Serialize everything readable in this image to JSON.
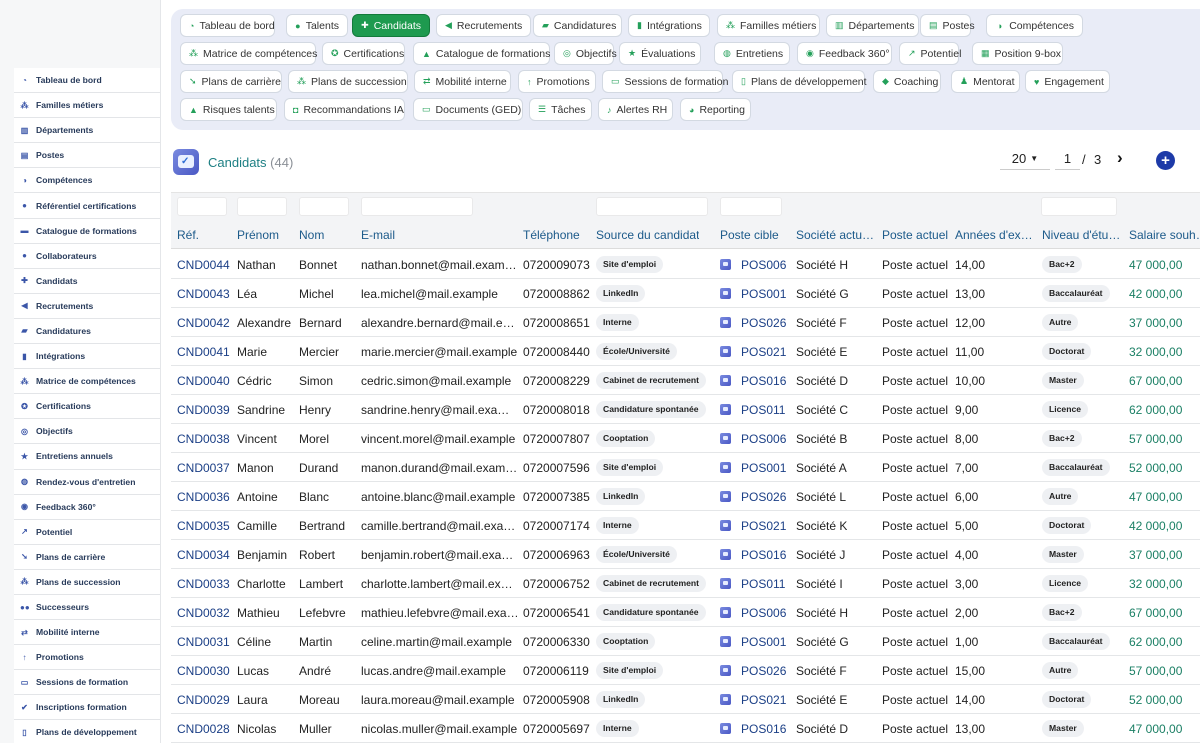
{
  "sidebar": {
    "items": [
      {
        "label": "Tableau de bord",
        "icon": "dashboard-icon"
      },
      {
        "label": "Familles métiers",
        "icon": "sitemap-icon"
      },
      {
        "label": "Départements",
        "icon": "building-icon"
      },
      {
        "label": "Postes",
        "icon": "id-card-icon"
      },
      {
        "label": "Compétences",
        "icon": "brain-icon"
      },
      {
        "label": "Référentiel certifications",
        "icon": "certificate-icon"
      },
      {
        "label": "Catalogue de formations",
        "icon": "book-icon"
      },
      {
        "label": "Collaborateurs",
        "icon": "user-icon"
      },
      {
        "label": "Candidats",
        "icon": "user-plus-icon"
      },
      {
        "label": "Recrutements",
        "icon": "megaphone-icon"
      },
      {
        "label": "Candidatures",
        "icon": "file-icon"
      },
      {
        "label": "Intégrations",
        "icon": "door-icon"
      },
      {
        "label": "Matrice de compétences",
        "icon": "sitemap-icon"
      },
      {
        "label": "Certifications",
        "icon": "award-icon"
      },
      {
        "label": "Objectifs",
        "icon": "target-icon"
      },
      {
        "label": "Entretiens annuels",
        "icon": "star-icon"
      },
      {
        "label": "Rendez-vous d'entretien",
        "icon": "chat-icon"
      },
      {
        "label": "Feedback 360°",
        "icon": "comment-icon"
      },
      {
        "label": "Potentiel",
        "icon": "chart-icon"
      },
      {
        "label": "Plans de carrière",
        "icon": "route-icon"
      },
      {
        "label": "Plans de succession",
        "icon": "sitemap-icon"
      },
      {
        "label": "Successeurs",
        "icon": "users-icon"
      },
      {
        "label": "Mobilité interne",
        "icon": "exchange-icon"
      },
      {
        "label": "Promotions",
        "icon": "arrow-up-icon"
      },
      {
        "label": "Sessions de formation",
        "icon": "presentation-icon"
      },
      {
        "label": "Inscriptions formation",
        "icon": "user-check-icon"
      },
      {
        "label": "Plans de développement",
        "icon": "clipboard-icon"
      }
    ]
  },
  "topnav": {
    "rows": [
      [
        {
          "label": "Tableau de bord",
          "icon": "dashboard-icon"
        },
        {
          "label": "Talents",
          "icon": "user-icon"
        },
        {
          "label": "Candidats",
          "icon": "user-plus-icon",
          "active": true
        },
        {
          "label": "Recrutements",
          "icon": "megaphone-icon"
        },
        {
          "label": "Candidatures",
          "icon": "file-icon"
        },
        {
          "label": "Intégrations",
          "icon": "door-icon"
        },
        {
          "label": "Familles métiers",
          "icon": "sitemap-icon"
        },
        {
          "label": "Départements",
          "icon": "building-icon"
        },
        {
          "label": "Postes",
          "icon": "id-card-icon"
        },
        {
          "label": "Compétences",
          "icon": "brain-icon"
        }
      ],
      [
        {
          "label": "Matrice de compétences",
          "icon": "sitemap-icon"
        },
        {
          "label": "Certifications",
          "icon": "award-icon"
        },
        {
          "label": "Catalogue de formations",
          "icon": "graduation-icon"
        },
        {
          "label": "Objectifs",
          "icon": "target-icon"
        },
        {
          "label": "Évaluations",
          "icon": "star-icon"
        },
        {
          "label": "Entretiens",
          "icon": "chat-icon"
        },
        {
          "label": "Feedback 360°",
          "icon": "comment-icon"
        },
        {
          "label": "Potentiel",
          "icon": "chart-icon"
        },
        {
          "label": "Position 9-box",
          "icon": "grid-icon"
        }
      ],
      [
        {
          "label": "Plans de carrière",
          "icon": "route-icon"
        },
        {
          "label": "Plans de succession",
          "icon": "sitemap-icon"
        },
        {
          "label": "Mobilité interne",
          "icon": "exchange-icon"
        },
        {
          "label": "Promotions",
          "icon": "arrow-up-icon"
        },
        {
          "label": "Sessions de formation",
          "icon": "presentation-icon"
        },
        {
          "label": "Plans de développement",
          "icon": "clipboard-icon"
        },
        {
          "label": "Coaching",
          "icon": "handshake-icon"
        },
        {
          "label": "Mentorat",
          "icon": "user-tie-icon"
        },
        {
          "label": "Engagement",
          "icon": "heart-icon"
        }
      ],
      [
        {
          "label": "Risques talents",
          "icon": "warning-icon"
        },
        {
          "label": "Recommandations IA",
          "icon": "robot-icon"
        },
        {
          "label": "Documents (GED)",
          "icon": "folder-icon"
        },
        {
          "label": "Tâches",
          "icon": "tasks-icon"
        },
        {
          "label": "Alertes RH",
          "icon": "bell-icon"
        },
        {
          "label": "Reporting",
          "icon": "pie-icon"
        }
      ]
    ]
  },
  "page": {
    "title": "Candidats",
    "count": "(44)",
    "page_size": "20",
    "current_page": "1",
    "separator": "/",
    "total_pages": "3",
    "next": "›",
    "add": "+"
  },
  "table": {
    "columns": [
      "Réf.",
      "Prénom",
      "Nom",
      "E-mail",
      "Téléphone",
      "Source du candidat",
      "Poste cible",
      "Société actuelle",
      "Poste actuel",
      "Années d'expérience",
      "Niveau d'études",
      "Salaire souhaité"
    ],
    "rows": [
      [
        "CND0044",
        "Nathan",
        "Bonnet",
        "nathan.bonnet@mail.example",
        "0720009073",
        "Site d'emploi",
        "POS006",
        "Société H",
        "Poste actuel",
        "14,00",
        "Bac+2",
        "47 000,00"
      ],
      [
        "CND0043",
        "Léa",
        "Michel",
        "lea.michel@mail.example",
        "0720008862",
        "LinkedIn",
        "POS001",
        "Société G",
        "Poste actuel",
        "13,00",
        "Baccalauréat",
        "42 000,00"
      ],
      [
        "CND0042",
        "Alexandre",
        "Bernard",
        "alexandre.bernard@mail.example",
        "0720008651",
        "Interne",
        "POS026",
        "Société F",
        "Poste actuel",
        "12,00",
        "Autre",
        "37 000,00"
      ],
      [
        "CND0041",
        "Marie",
        "Mercier",
        "marie.mercier@mail.example",
        "0720008440",
        "École/Université",
        "POS021",
        "Société E",
        "Poste actuel",
        "11,00",
        "Doctorat",
        "32 000,00"
      ],
      [
        "CND0040",
        "Cédric",
        "Simon",
        "cedric.simon@mail.example",
        "0720008229",
        "Cabinet de recrutement",
        "POS016",
        "Société D",
        "Poste actuel",
        "10,00",
        "Master",
        "67 000,00"
      ],
      [
        "CND0039",
        "Sandrine",
        "Henry",
        "sandrine.henry@mail.example",
        "0720008018",
        "Candidature spontanée",
        "POS011",
        "Société C",
        "Poste actuel",
        "9,00",
        "Licence",
        "62 000,00"
      ],
      [
        "CND0038",
        "Vincent",
        "Morel",
        "vincent.morel@mail.example",
        "0720007807",
        "Cooptation",
        "POS006",
        "Société B",
        "Poste actuel",
        "8,00",
        "Bac+2",
        "57 000,00"
      ],
      [
        "CND0037",
        "Manon",
        "Durand",
        "manon.durand@mail.example",
        "0720007596",
        "Site d'emploi",
        "POS001",
        "Société A",
        "Poste actuel",
        "7,00",
        "Baccalauréat",
        "52 000,00"
      ],
      [
        "CND0036",
        "Antoine",
        "Blanc",
        "antoine.blanc@mail.example",
        "0720007385",
        "LinkedIn",
        "POS026",
        "Société L",
        "Poste actuel",
        "6,00",
        "Autre",
        "47 000,00"
      ],
      [
        "CND0035",
        "Camille",
        "Bertrand",
        "camille.bertrand@mail.example",
        "0720007174",
        "Interne",
        "POS021",
        "Société K",
        "Poste actuel",
        "5,00",
        "Doctorat",
        "42 000,00"
      ],
      [
        "CND0034",
        "Benjamin",
        "Robert",
        "benjamin.robert@mail.example",
        "0720006963",
        "École/Université",
        "POS016",
        "Société J",
        "Poste actuel",
        "4,00",
        "Master",
        "37 000,00"
      ],
      [
        "CND0033",
        "Charlotte",
        "Lambert",
        "charlotte.lambert@mail.example",
        "0720006752",
        "Cabinet de recrutement",
        "POS011",
        "Société I",
        "Poste actuel",
        "3,00",
        "Licence",
        "32 000,00"
      ],
      [
        "CND0032",
        "Mathieu",
        "Lefebvre",
        "mathieu.lefebvre@mail.example",
        "0720006541",
        "Candidature spontanée",
        "POS006",
        "Société H",
        "Poste actuel",
        "2,00",
        "Bac+2",
        "67 000,00"
      ],
      [
        "CND0031",
        "Céline",
        "Martin",
        "celine.martin@mail.example",
        "0720006330",
        "Cooptation",
        "POS001",
        "Société G",
        "Poste actuel",
        "1,00",
        "Baccalauréat",
        "62 000,00"
      ],
      [
        "CND0030",
        "Lucas",
        "André",
        "lucas.andre@mail.example",
        "0720006119",
        "Site d'emploi",
        "POS026",
        "Société F",
        "Poste actuel",
        "15,00",
        "Autre",
        "57 000,00"
      ],
      [
        "CND0029",
        "Laura",
        "Moreau",
        "laura.moreau@mail.example",
        "0720005908",
        "LinkedIn",
        "POS021",
        "Société E",
        "Poste actuel",
        "14,00",
        "Doctorat",
        "52 000,00"
      ],
      [
        "CND0028",
        "Nicolas",
        "Muller",
        "nicolas.muller@mail.example",
        "0720005697",
        "Interne",
        "POS016",
        "Société D",
        "Poste actuel",
        "13,00",
        "Master",
        "47 000,00"
      ]
    ]
  },
  "colors": {
    "accent": "#1e9a4f",
    "title": "#1d7f83",
    "link": "#1b3f86",
    "salary": "#1a7f64",
    "add_button": "#1d3aa8"
  }
}
